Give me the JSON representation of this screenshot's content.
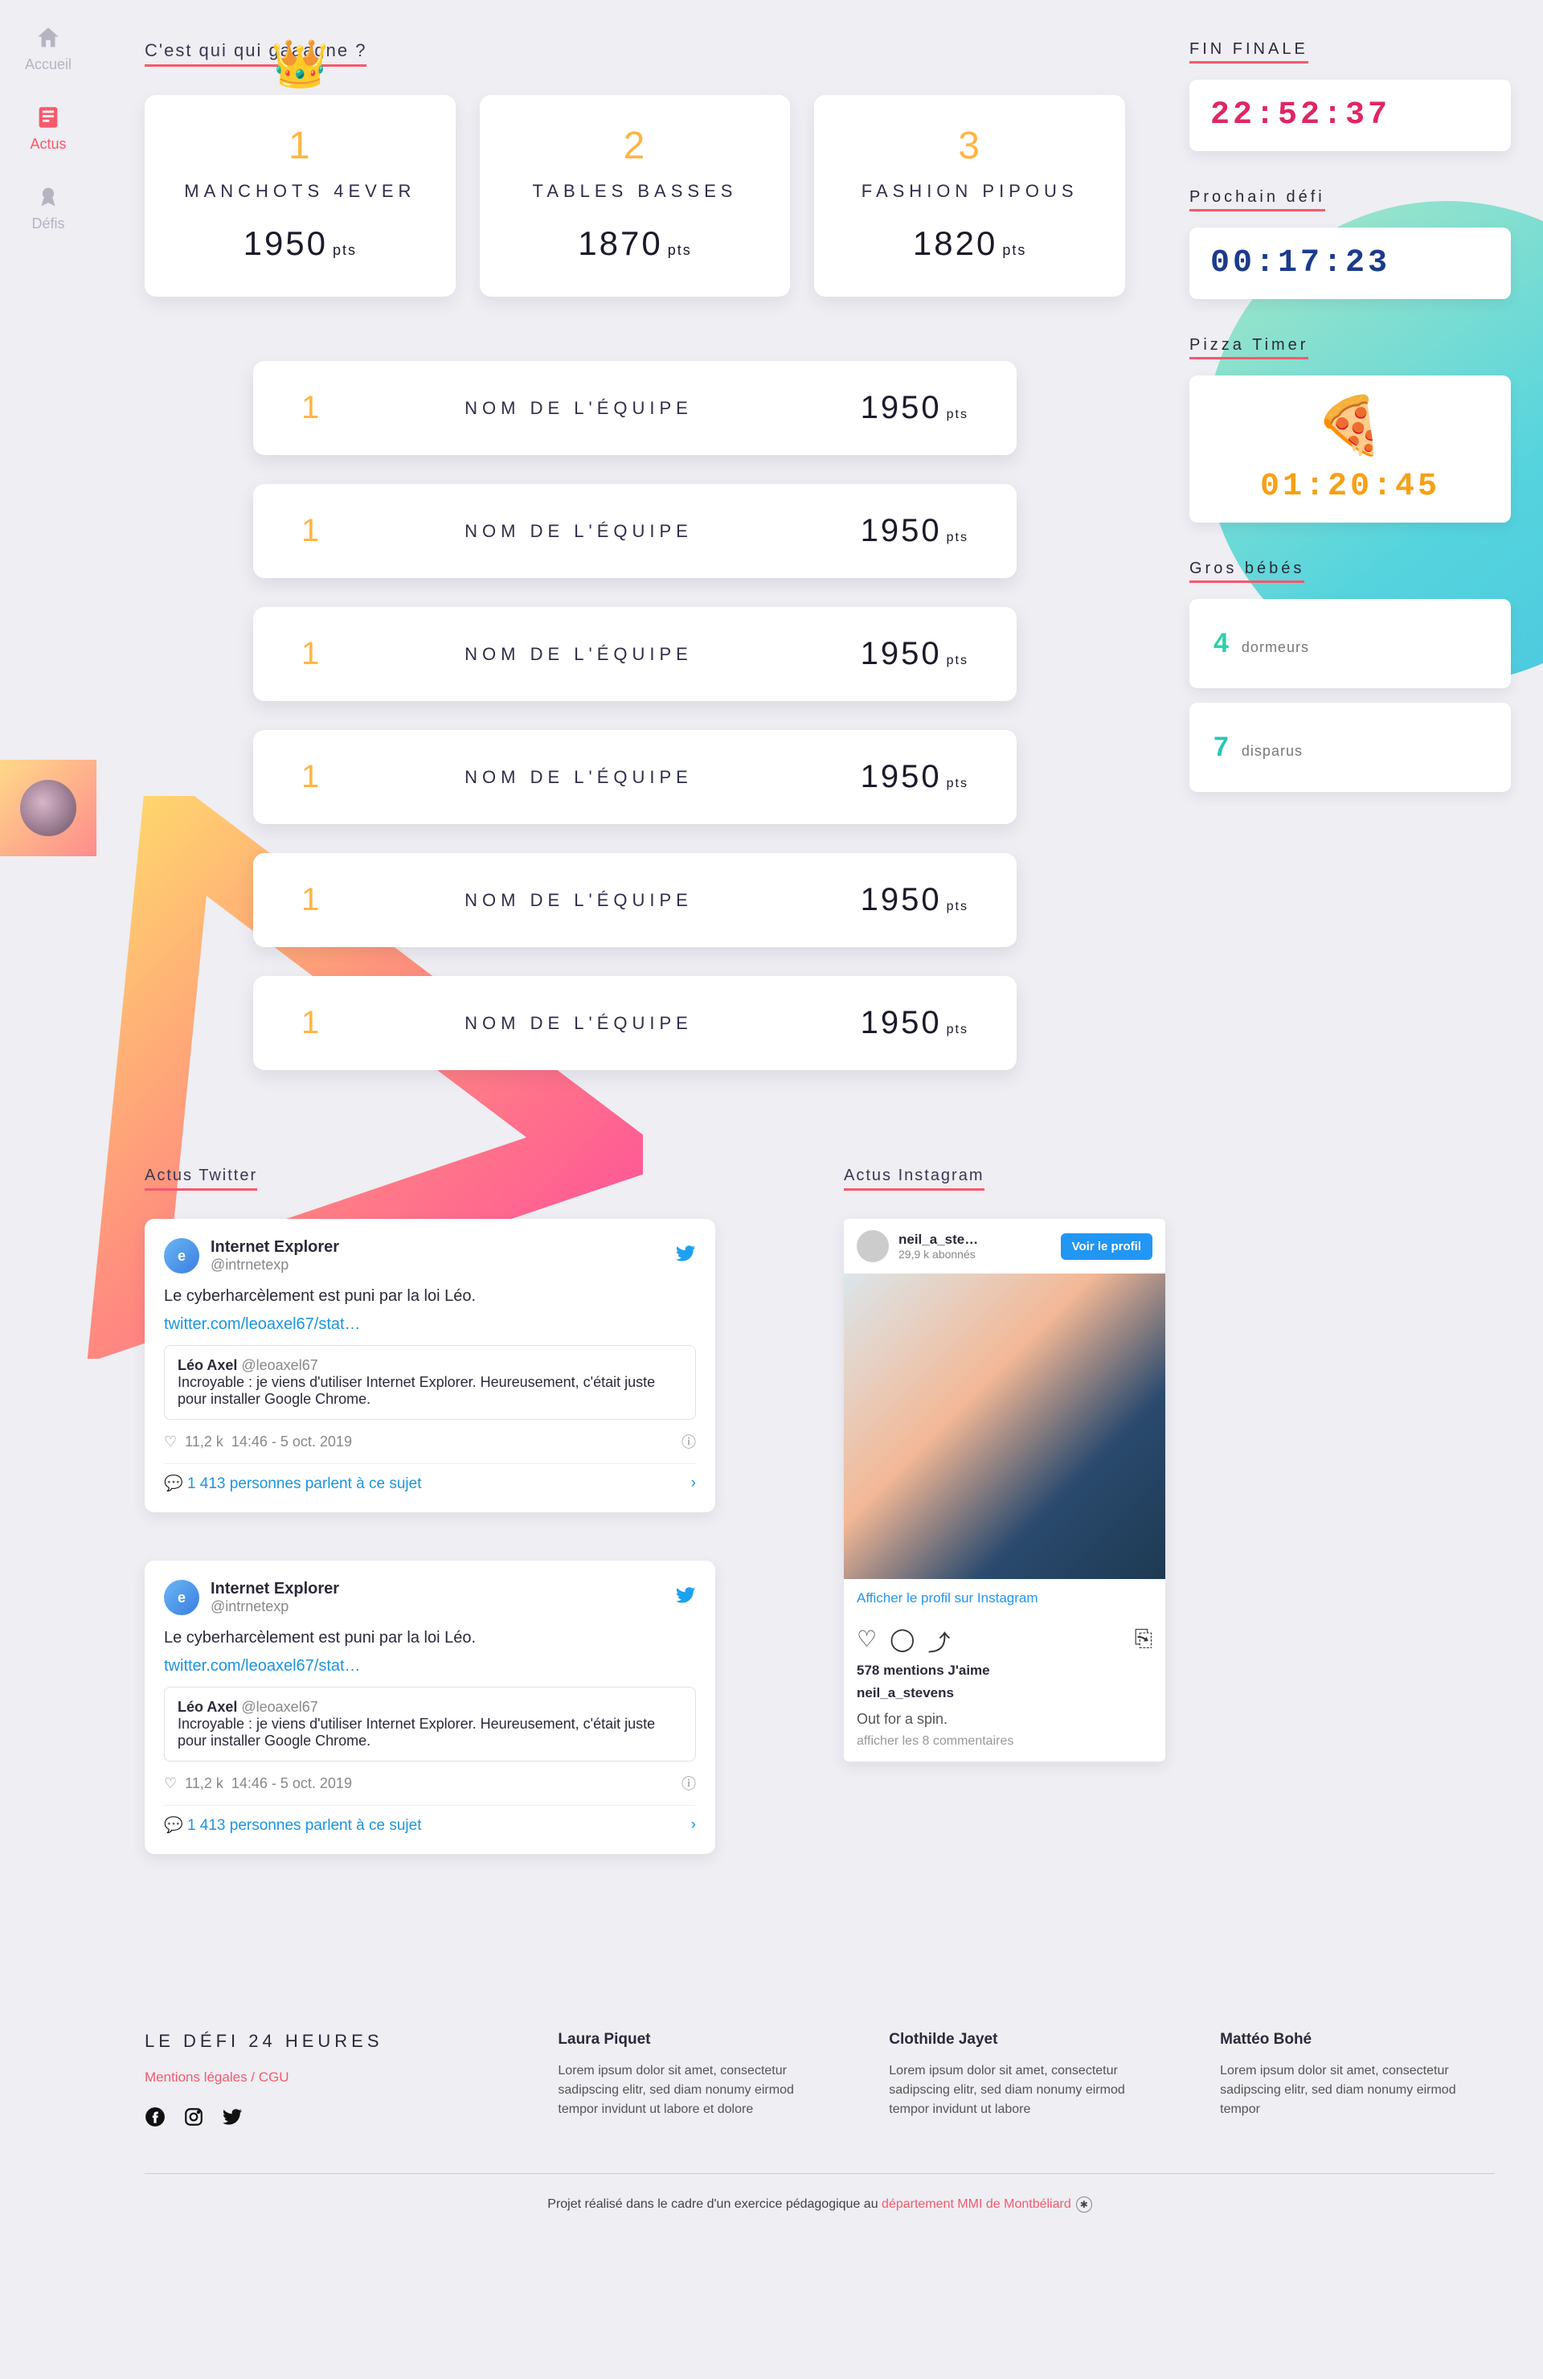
{
  "sidebar": {
    "items": [
      {
        "label": "Accueil",
        "active": false
      },
      {
        "label": "Actus",
        "active": true
      },
      {
        "label": "Défis",
        "active": false
      }
    ]
  },
  "leaderboard": {
    "title": "C'est qui qui gaaagne ?",
    "podium": [
      {
        "rank": "1",
        "team": "MANCHOTS 4EVER",
        "points": "1950",
        "pts_label": "pts"
      },
      {
        "rank": "2",
        "team": "TABLES BASSES",
        "points": "1870",
        "pts_label": "pts"
      },
      {
        "rank": "3",
        "team": "FASHION PIPOUS",
        "points": "1820",
        "pts_label": "pts"
      }
    ],
    "rows": [
      {
        "rank": "1",
        "team": "NOM DE L'ÉQUIPE",
        "points": "1950",
        "pts_label": "pts"
      },
      {
        "rank": "1",
        "team": "NOM DE L'ÉQUIPE",
        "points": "1950",
        "pts_label": "pts"
      },
      {
        "rank": "1",
        "team": "NOM DE L'ÉQUIPE",
        "points": "1950",
        "pts_label": "pts"
      },
      {
        "rank": "1",
        "team": "NOM DE L'ÉQUIPE",
        "points": "1950",
        "pts_label": "pts"
      },
      {
        "rank": "1",
        "team": "NOM DE L'ÉQUIPE",
        "points": "1950",
        "pts_label": "pts"
      },
      {
        "rank": "1",
        "team": "NOM DE L'ÉQUIPE",
        "points": "1950",
        "pts_label": "pts"
      }
    ]
  },
  "timers": {
    "final": {
      "title": "FIN FINALE",
      "value": "22:52:37"
    },
    "next": {
      "title": "Prochain défi",
      "value": "00:17:23"
    },
    "pizza": {
      "title": "Pizza Timer",
      "value": "01:20:45"
    }
  },
  "babies": {
    "title": "Gros bébés",
    "sleepers": {
      "num": "4",
      "label": "dormeurs"
    },
    "missing": {
      "num": "7",
      "label": "disparus"
    }
  },
  "feeds": {
    "twitter_title": "Actus Twitter",
    "instagram_title": "Actus Instagram",
    "tweets": [
      {
        "user": "Internet Explorer",
        "handle": "@intrnetexp",
        "body": "Le cyberharcèlement est puni par la loi Léo.",
        "link": "twitter.com/leoaxel67/stat…",
        "quote_user": "Léo Axel",
        "quote_handle": "@leoaxel67",
        "quote_body": "Incroyable : je viens d'utiliser Internet Explorer. Heureusement, c'était juste pour installer Google Chrome.",
        "likes": "11,2 k",
        "time": "14:46 - 5 oct. 2019",
        "talk": "1 413 personnes parlent à ce sujet"
      },
      {
        "user": "Internet Explorer",
        "handle": "@intrnetexp",
        "body": "Le cyberharcèlement est puni par la loi Léo.",
        "link": "twitter.com/leoaxel67/stat…",
        "quote_user": "Léo Axel",
        "quote_handle": "@leoaxel67",
        "quote_body": "Incroyable : je viens d'utiliser Internet Explorer. Heureusement, c'était juste pour installer Google Chrome.",
        "likes": "11,2 k",
        "time": "14:46 - 5 oct. 2019",
        "talk": "1 413 personnes parlent à ce sujet"
      }
    ],
    "instagram": {
      "user": "neil_a_ste…",
      "followers": "29,9 k abonnés",
      "btn": "Voir le profil",
      "link": "Afficher le profil sur Instagram",
      "likes": "578 mentions J'aime",
      "username": "neil_a_stevens",
      "caption": "Out for a spin.",
      "comments": "afficher les 8 commentaires"
    }
  },
  "footer": {
    "brand": "LE DÉFI 24 HEURES",
    "legal": "Mentions légales / CGU",
    "columns": [
      {
        "name": "Laura Piquet",
        "text": "Lorem ipsum dolor sit amet, consectetur sadipscing elitr, sed diam nonumy eirmod tempor invidunt ut labore et dolore"
      },
      {
        "name": "Clothilde Jayet",
        "text": "Lorem ipsum dolor sit amet, consectetur sadipscing elitr, sed diam nonumy eirmod tempor invidunt ut labore"
      },
      {
        "name": "Mattéo Bohé",
        "text": "Lorem ipsum dolor sit amet, consectetur sadipscing elitr, sed diam nonumy eirmod tempor"
      }
    ],
    "bottom_pre": "Projet réalisé dans le cadre d'un exercice pédagogique au ",
    "bottom_link": "département MMI de Montbéliard"
  }
}
